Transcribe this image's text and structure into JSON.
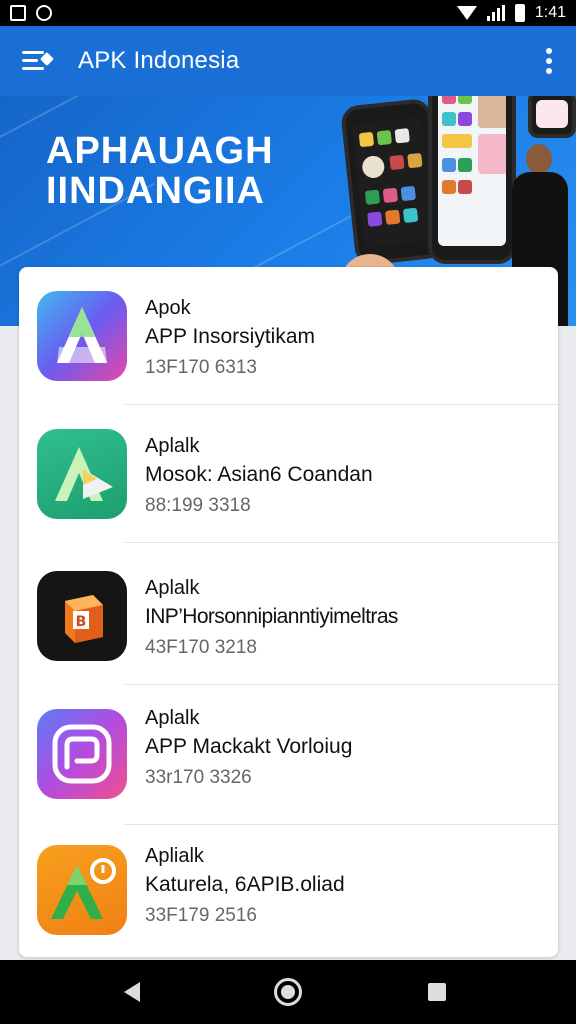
{
  "status_bar": {
    "time": "1:41",
    "icons": [
      "image-icon",
      "sync-icon",
      "wifi-icon",
      "signal-icon",
      "battery-icon"
    ]
  },
  "app_bar": {
    "title": "APK Indonesia",
    "icons": [
      "menu-icon",
      "more-vert-icon"
    ],
    "color": "#1a6fd6"
  },
  "banner": {
    "title_line1": "APHAUAGH",
    "title_line2": "IINDANGIIA"
  },
  "apps": [
    {
      "label": "Apok",
      "name": "APP Insorsiytikam",
      "meta": "13F170 6313",
      "icon": "arrow-a-icon"
    },
    {
      "label": "Aplalk",
      "name": "Mosok: Asian6 Coandan",
      "meta": "88:199 3318",
      "icon": "arrow-a-icon"
    },
    {
      "label": "Aplalk",
      "name": "INP’Horsonnipianntiyimeltras",
      "meta": "43F170 3218",
      "icon": "box-icon"
    },
    {
      "label": "Aplalk",
      "name": "APP Mackakt Vorloiug",
      "meta": "33r170 3326",
      "icon": "ring-icon"
    },
    {
      "label": "Aplialk",
      "name": "Katurela, 6APIB.oliad",
      "meta": "33F179 2516",
      "icon": "arrow-a-icon"
    }
  ],
  "nav_bar": {
    "icons": [
      "back-icon",
      "home-icon",
      "recent-apps-icon"
    ]
  }
}
